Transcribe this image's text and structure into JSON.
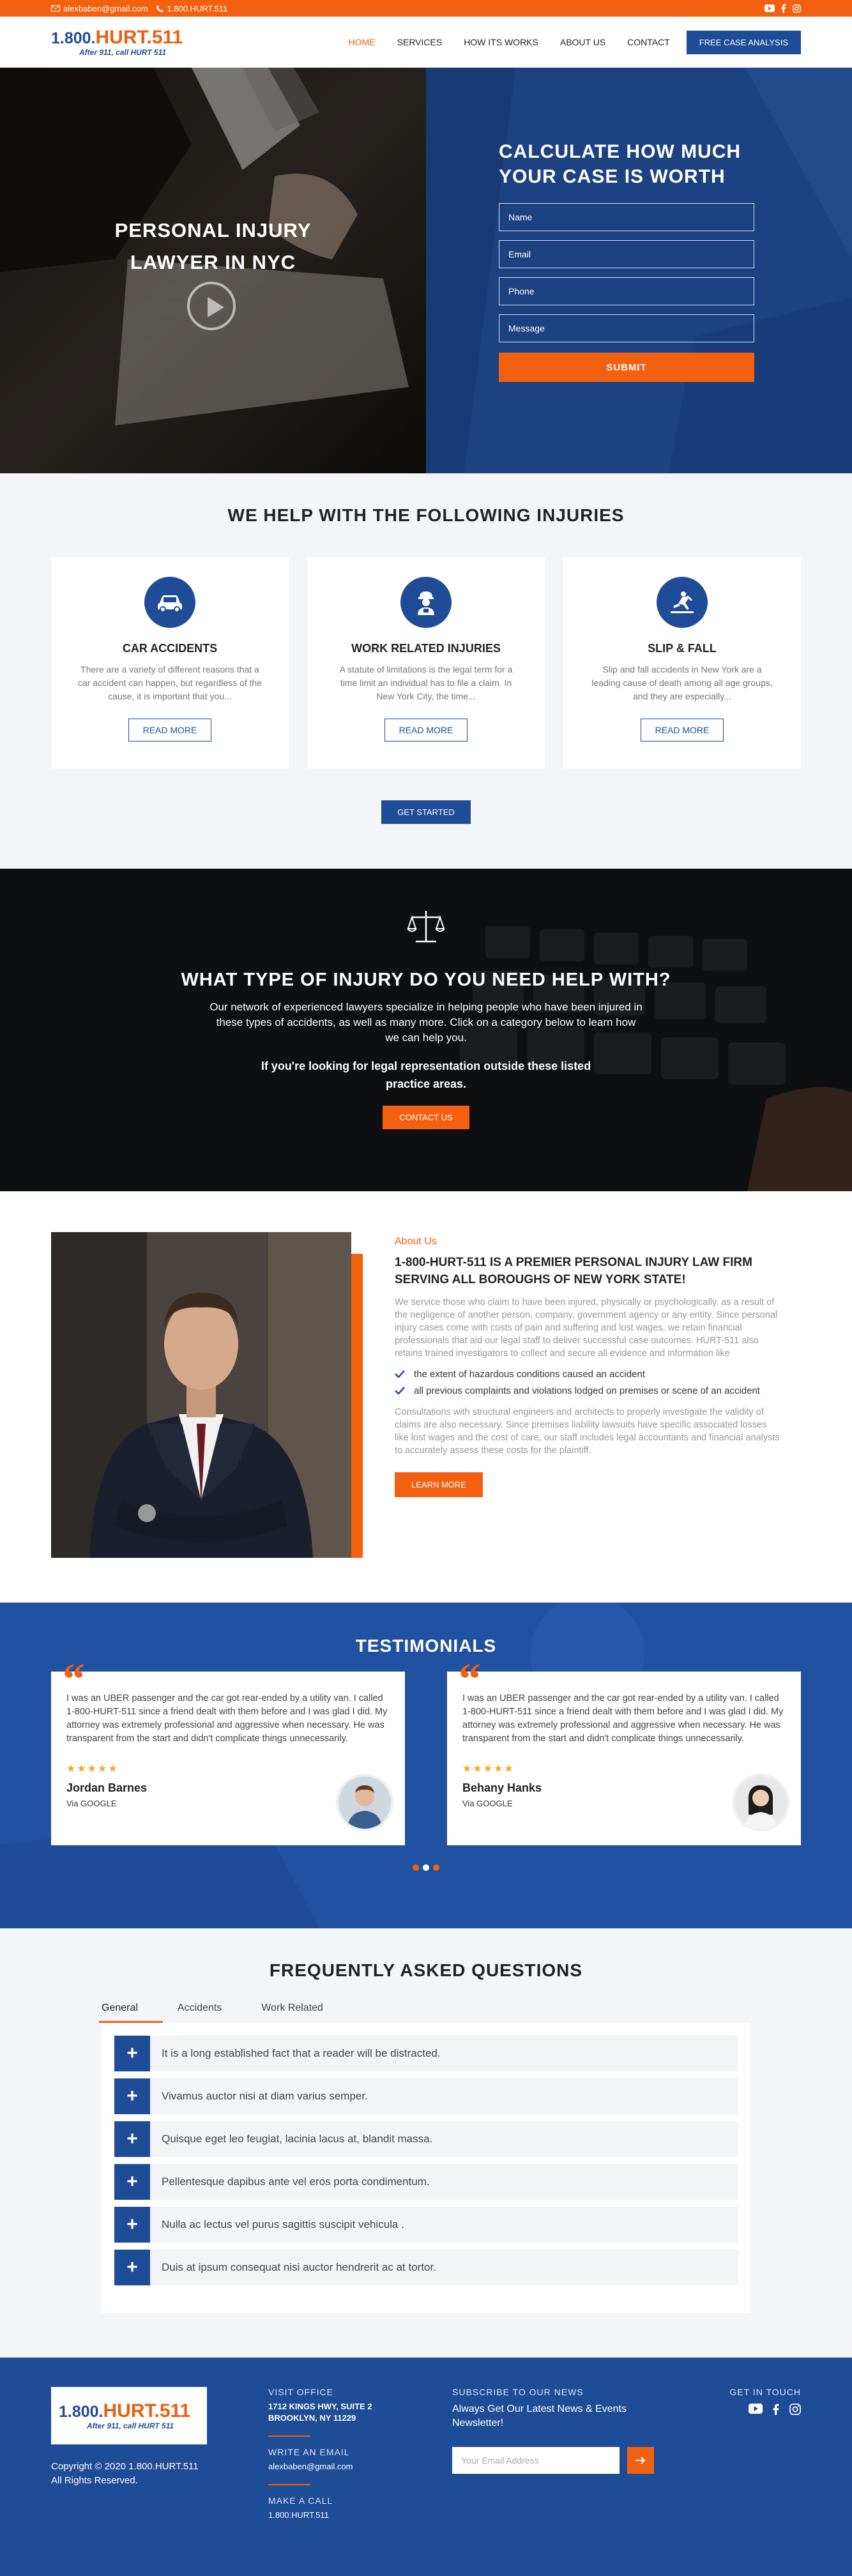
{
  "topbar": {
    "email": "alexbaben@gmail.com",
    "phone": "1.800.HURT.511"
  },
  "brand": {
    "prefix": "1.800.",
    "name": "HURT.511",
    "tagline": "After 911, call HURT 511"
  },
  "nav": {
    "items": [
      "HOME",
      "SERVICES",
      "HOW ITS WORKS",
      "ABOUT US",
      "CONTACT"
    ],
    "cta": "FREE CASE ANALYSIS"
  },
  "hero": {
    "title_line1": "PERSONAL INJURY",
    "title_line2": "LAWYER IN NYC",
    "form_title_line1": "CALCULATE HOW MUCH",
    "form_title_line2": "YOUR CASE IS WORTH",
    "placeholders": {
      "name": "Name",
      "email": "Email",
      "phone": "Phone",
      "message": "Message"
    },
    "submit": "SUBMIT"
  },
  "injuries": {
    "title": "WE HELP WITH THE FOLLOWING INJURIES",
    "cards": [
      {
        "icon": "car-icon",
        "title": "CAR ACCIDENTS",
        "text": "There are a variety of different reasons that a car accident can happen, but regardless of the cause, it is important that you...",
        "btn": "READ MORE"
      },
      {
        "icon": "worker-icon",
        "title": "WORK RELATED INJURIES",
        "text": "A statute of limitations is the legal term for a time limit an individual has to file a claim. In New York City, the time...",
        "btn": "READ MORE"
      },
      {
        "icon": "slip-fall-icon",
        "title": "SLIP & FALL",
        "text": "Slip and fall accidents in New York are a leading cause of death among all age groups, and they are especially...",
        "btn": "READ MORE"
      }
    ],
    "cta": "GET STARTED"
  },
  "help": {
    "title": "WHAT TYPE OF INJURY DO YOU NEED HELP WITH?",
    "text": "Our network of experienced lawyers specialize in helping people who have been injured in these types of accidents, as well as many more. Click on a category below to learn how we can help you.",
    "bold": "If you're looking for legal representation outside these listed practice areas.",
    "btn": "CONTACT US"
  },
  "about": {
    "tag": "About Us",
    "title": "1-800-HURT-511 IS A PREMIER PERSONAL INJURY LAW FIRM SERVING ALL BOROUGHS OF NEW YORK STATE!",
    "p1": "We service those who claim to have been injured, physically or psychologically, as a result of the negligence of another person, company, government agency or any entity. Since personal injury cases come with costs of pain and suffering and lost wages, we retain financial professionals that aid our legal staff to deliver successful case outcomes. HURT-511 also retains trained investigators to collect and secure all evidence and information like",
    "checks": [
      "the extent of hazardous conditions caused an accident",
      "all previous complaints and violations lodged on premises or scene of an accident"
    ],
    "p2": "Consultations with structural engineers and architects to properly investigate the validity of claims are also necessary. Since premises liability lawsuits have specific associated losses like lost wages and the cost of care, our staff includes legal accountants and financial analysts to accurately assess these costs for the plaintiff.",
    "btn": "LEARN MORE"
  },
  "testimonials": {
    "title": "TESTIMONIALS",
    "items": [
      {
        "text": "I was an UBER passenger and the car got rear-ended by a utility van. I called 1-800-HURT-511 since a friend dealt with them before and I was glad I did. My attorney was extremely professional and aggressive when necessary. He was transparent from the start and didn't complicate things unnecessarily.",
        "stars": "★★★★★",
        "name": "Jordan Barnes",
        "via": "Via GOOGLE"
      },
      {
        "text": "I was an UBER passenger and the car got rear-ended by a utility van. I called 1-800-HURT-511 since a friend dealt with them before and I was glad I did. My attorney was extremely professional and aggressive when necessary. He was transparent from the start and didn't complicate things unnecessarily.",
        "stars": "★★★★★",
        "name": "Behany Hanks",
        "via": "Via GOOGLE"
      }
    ]
  },
  "faq": {
    "title": "FREQUENTLY ASKED QUESTIONS",
    "tabs": [
      "General",
      "Accidents",
      "Work Related"
    ],
    "items": [
      "It is a long established fact that a reader will be distracted.",
      "Vivamus auctor nisi at diam varius semper.",
      "Quisque eget leo feugiat, lacinia lacus at, blandit massa.",
      "Pellentesque dapibus ante vel eros porta condimentum.",
      "Nulla ac lectus vel purus sagittis suscipit vehicula .",
      "Duis at ipsum consequat nisi auctor hendrerit ac at tortor."
    ]
  },
  "footer": {
    "copyright_line1": "Copyright © 2020 1.800.HURT.511",
    "copyright_line2": "All Rights Reserved.",
    "visit_label": "VISIT OFFICE",
    "address_line1": "1712 KINGS HWY, SUITE 2",
    "address_line2": "BROOKLYN, NY 11229",
    "email_label": "WRITE AN EMAIL",
    "email": "alexbaben@gmail.com",
    "call_label": "MAKE A CALL",
    "phone": "1.800.HURT.511",
    "subscribe_label": "SUBSCRIBE TO OUR NEWS",
    "subscribe_text": "Always Get Our Latest News & Events Newsletter!",
    "subscribe_placeholder": "Your Email Address",
    "getintouch": "GET IN TOUCH"
  },
  "colors": {
    "accent": "#f36010",
    "brand": "#1f4c97"
  }
}
